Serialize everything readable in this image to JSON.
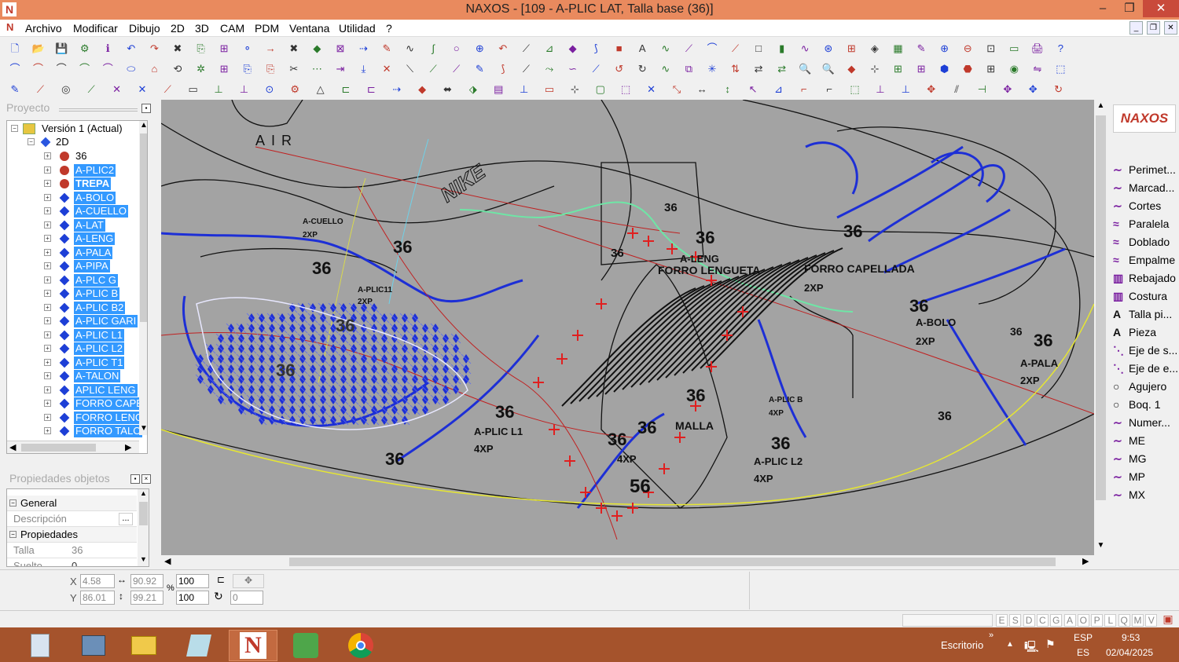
{
  "window": {
    "title": "NAXOS - [109 - A-PLIC LAT, Talla base (36)]",
    "min": "–",
    "max": "❐",
    "close": "✕"
  },
  "menu": [
    "Archivo",
    "Modificar",
    "Dibujo",
    "2D",
    "3D",
    "CAM",
    "PDM",
    "Ventana",
    "Utilidad",
    "?"
  ],
  "project_panel": {
    "title": "Proyecto"
  },
  "tree": {
    "root": "Versión 1 (Actual)",
    "group": "2D",
    "items": [
      {
        "label": "36",
        "icon": "red-circle",
        "selected": false,
        "bold": false
      },
      {
        "label": "A-PLIC2",
        "icon": "red-circle",
        "selected": true,
        "bold": false
      },
      {
        "label": "TREPA",
        "icon": "red-circle",
        "selected": true,
        "bold": true
      },
      {
        "label": "A-BOLO",
        "icon": "blue-diamond",
        "selected": true,
        "bold": false
      },
      {
        "label": "A-CUELLO",
        "icon": "blue-diamond",
        "selected": true,
        "bold": false
      },
      {
        "label": "A-LAT",
        "icon": "blue-diamond",
        "selected": true,
        "bold": false
      },
      {
        "label": "A-LENG",
        "icon": "blue-diamond",
        "selected": true,
        "bold": false
      },
      {
        "label": "A-PALA",
        "icon": "blue-diamond",
        "selected": true,
        "bold": false
      },
      {
        "label": "A-PIPA",
        "icon": "blue-diamond",
        "selected": true,
        "bold": false
      },
      {
        "label": "A-PLC G",
        "icon": "blue-diamond",
        "selected": true,
        "bold": false
      },
      {
        "label": "A-PLIC B",
        "icon": "blue-diamond",
        "selected": true,
        "bold": false
      },
      {
        "label": "A-PLIC B2",
        "icon": "blue-diamond",
        "selected": true,
        "bold": false
      },
      {
        "label": "A-PLIC GARI",
        "icon": "blue-diamond",
        "selected": true,
        "bold": false
      },
      {
        "label": "A-PLIC L1",
        "icon": "blue-diamond",
        "selected": true,
        "bold": false
      },
      {
        "label": "A-PLIC L2",
        "icon": "blue-diamond",
        "selected": true,
        "bold": false
      },
      {
        "label": "A-PLIC T1",
        "icon": "blue-diamond",
        "selected": true,
        "bold": false
      },
      {
        "label": "A-TALON",
        "icon": "blue-diamond",
        "selected": true,
        "bold": false
      },
      {
        "label": "APLIC LENG",
        "icon": "blue-diamond",
        "selected": true,
        "bold": false
      },
      {
        "label": "FORRO CAPE",
        "icon": "blue-diamond",
        "selected": true,
        "bold": false
      },
      {
        "label": "FORRO LENG",
        "icon": "blue-diamond",
        "selected": true,
        "bold": false
      },
      {
        "label": "FORRO TALO",
        "icon": "blue-diamond",
        "selected": true,
        "bold": false
      }
    ]
  },
  "properties_panel": {
    "title": "Propiedades objetos",
    "sections": [
      {
        "type": "section",
        "label": "General"
      },
      {
        "type": "row",
        "label": "Descripción",
        "value": "",
        "button": "..."
      },
      {
        "type": "section",
        "label": "Propiedades"
      },
      {
        "type": "row",
        "label": "Talla",
        "value": "36"
      },
      {
        "type": "row",
        "label": "Suelto",
        "value": "0"
      }
    ]
  },
  "right_panel": {
    "logo": "NAXOS",
    "items": [
      {
        "label": "Perimet...",
        "icon": "curve"
      },
      {
        "label": "Marcad...",
        "icon": "curve"
      },
      {
        "label": "Cortes",
        "icon": "curve"
      },
      {
        "label": "Paralela",
        "icon": "parallel"
      },
      {
        "label": "Doblado",
        "icon": "parallel"
      },
      {
        "label": "Empalme",
        "icon": "parallel"
      },
      {
        "label": "Rebajado",
        "icon": "hatch"
      },
      {
        "label": "Costura",
        "icon": "hatch"
      },
      {
        "label": "Talla pi...",
        "icon": "text-A"
      },
      {
        "label": "Pieza",
        "icon": "text-A"
      },
      {
        "label": "Eje de s...",
        "icon": "dashed"
      },
      {
        "label": "Eje de e...",
        "icon": "dashed"
      },
      {
        "label": "Agujero",
        "icon": "circle"
      },
      {
        "label": "Boq. 1",
        "icon": "circle"
      },
      {
        "label": "Numer...",
        "icon": "curve"
      },
      {
        "label": "ME",
        "icon": "curve"
      },
      {
        "label": "MG",
        "icon": "curve"
      },
      {
        "label": "MP",
        "icon": "curve"
      },
      {
        "label": "MX",
        "icon": "curve"
      }
    ]
  },
  "drawing_labels": [
    {
      "text": "AIR"
    },
    {
      "text": "NIKE"
    },
    {
      "text": "A-CUELLO"
    },
    {
      "text": "2XP"
    },
    {
      "text": "36"
    },
    {
      "text": "A-PLIC11"
    },
    {
      "text": "A-LENG"
    },
    {
      "text": "FORRO LENGUETA"
    },
    {
      "text": "FORRO CAPELLADA"
    },
    {
      "text": "A-BOLO"
    },
    {
      "text": "A-PALA"
    },
    {
      "text": "A-PLIC L1"
    },
    {
      "text": "4XP"
    },
    {
      "text": "A-PLIC L2"
    },
    {
      "text": "MALLA"
    },
    {
      "text": "A-PLIC B"
    },
    {
      "text": "56"
    }
  ],
  "coords": {
    "x_label": "X",
    "y_label": "Y",
    "x": "4.58",
    "y": "86.01",
    "w": "90.92",
    "h": "99.21",
    "scale_x": "100",
    "scale_y": "100",
    "angle": "0",
    "pct": "%"
  },
  "status_letters": [
    "E",
    "S",
    "D",
    "C",
    "G",
    "A",
    "O",
    "P",
    "L",
    "Q",
    "M",
    "V"
  ],
  "taskbar": {
    "desktop": "Escritorio",
    "lang1": "ESP",
    "lang2": "ES",
    "time": "9:53",
    "date": "02/04/2025"
  }
}
